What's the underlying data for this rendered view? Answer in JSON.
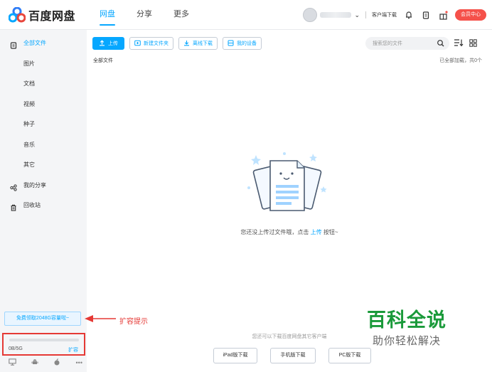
{
  "header": {
    "logo_text": "百度网盘",
    "nav": [
      {
        "label": "网盘",
        "active": true
      },
      {
        "label": "分享",
        "active": false
      },
      {
        "label": "更多",
        "active": false
      }
    ],
    "client_download": "客户端下载",
    "member_center": "会员中心"
  },
  "sidebar": {
    "items": [
      {
        "label": "全部文件",
        "icon": "file-icon",
        "active": true
      },
      {
        "label": "图片",
        "icon": "",
        "active": false
      },
      {
        "label": "文档",
        "icon": "",
        "active": false
      },
      {
        "label": "视频",
        "icon": "",
        "active": false
      },
      {
        "label": "种子",
        "icon": "",
        "active": false
      },
      {
        "label": "音乐",
        "icon": "",
        "active": false
      },
      {
        "label": "其它",
        "icon": "",
        "active": false
      },
      {
        "label": "我的分享",
        "icon": "share-icon",
        "active": false
      },
      {
        "label": "回收站",
        "icon": "trash-icon",
        "active": false
      }
    ],
    "free_capacity": "免费领取2048G容量啦~",
    "quota": {
      "text": "0B/5G",
      "used_fraction": 0.0,
      "expand": "扩容"
    }
  },
  "toolbar": {
    "upload": "上传",
    "new_folder": "新建文件夹",
    "offline_download": "离线下载",
    "my_devices": "我的设备"
  },
  "search": {
    "placeholder": "搜索您的文件"
  },
  "main": {
    "breadcrumb": "全部文件",
    "loaded_status": "已全部加载，共0个",
    "empty_prefix": "您还没上传过文件哦，点击",
    "empty_link": "上传",
    "empty_suffix": "按钮~",
    "client_hint": "您还可以下载百度网盘其它客户端",
    "downloads": [
      "iPad版下载",
      "手机版下载",
      "PC版下载"
    ]
  },
  "annotation": {
    "label": "扩容提示",
    "color": "#e53935"
  },
  "watermark": {
    "title": "百科全说",
    "subtitle": "助你轻松解决"
  },
  "colors": {
    "accent": "#06a7ff",
    "member": "#f5514a",
    "sidebar_bg": "#f4f5f7"
  }
}
